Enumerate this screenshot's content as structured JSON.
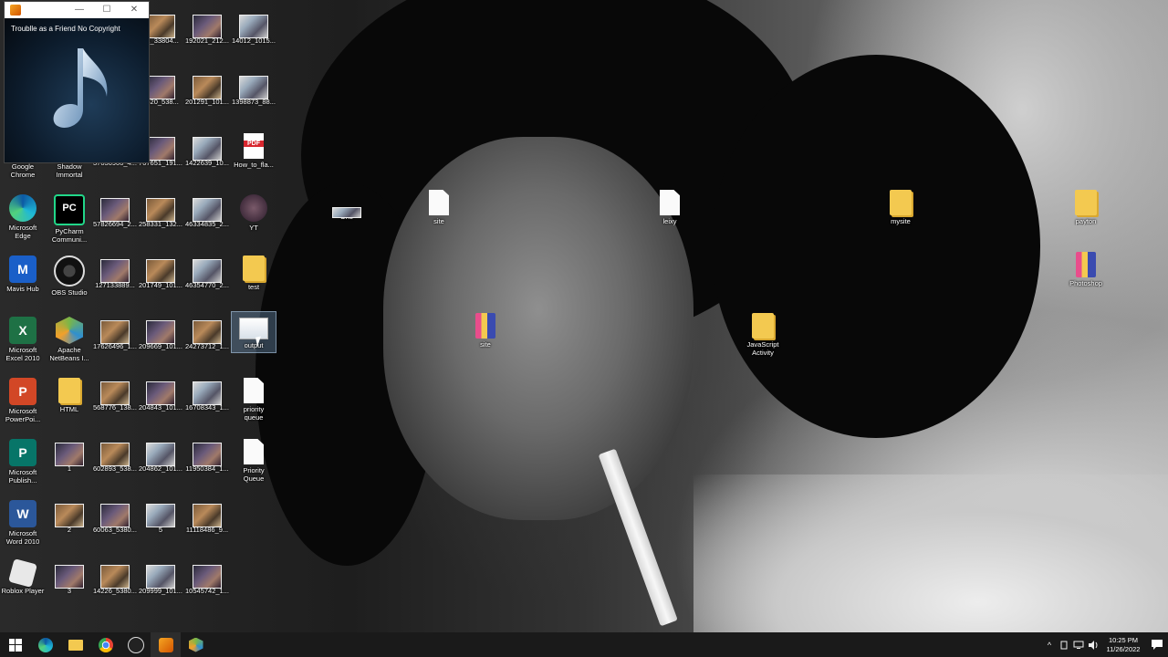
{
  "media_player": {
    "track_title": "Troublle as a Friend No Copyright",
    "controls": {
      "minimize": "—",
      "maximize": "☐",
      "close": "✕"
    },
    "art": "music-note-icon"
  },
  "desktop": {
    "icons": [
      {
        "label": "92_33804...",
        "kind": "thumb"
      },
      {
        "label": "192021_212...",
        "kind": "thumb"
      },
      {
        "label": "14012_1015...",
        "kind": "thumb"
      },
      {
        "label": "3620_538...",
        "kind": "thumb"
      },
      {
        "label": "201291_101...",
        "kind": "thumb"
      },
      {
        "label": "1398873_88...",
        "kind": "thumb"
      },
      {
        "label": "Google\nChrome",
        "kind": "app"
      },
      {
        "label": "Shadow\nImmortal",
        "kind": "app"
      },
      {
        "label": "37030900_4...",
        "kind": "thumb"
      },
      {
        "label": "767651_191...",
        "kind": "thumb"
      },
      {
        "label": "1422639_10...",
        "kind": "thumb"
      },
      {
        "label": "How_to_fla...",
        "kind": "pdf"
      },
      {
        "label": "Microsoft\nEdge",
        "kind": "app"
      },
      {
        "label": "PyCharm\nCommuni...",
        "kind": "app"
      },
      {
        "label": "57826694_2...",
        "kind": "thumb"
      },
      {
        "label": "258331_132...",
        "kind": "thumb"
      },
      {
        "label": "46334835_2...",
        "kind": "thumb"
      },
      {
        "label": "YT",
        "kind": "thumb"
      },
      {
        "label": "Mavis Hub",
        "kind": "app"
      },
      {
        "label": "OBS Studio",
        "kind": "app"
      },
      {
        "label": "127133889...",
        "kind": "thumb"
      },
      {
        "label": "201749_101...",
        "kind": "thumb"
      },
      {
        "label": "46354770_2...",
        "kind": "thumb"
      },
      {
        "label": "test",
        "kind": "folder"
      },
      {
        "label": "Microsoft\nExcel 2010",
        "kind": "app"
      },
      {
        "label": "Apache\nNetBeans I...",
        "kind": "app"
      },
      {
        "label": "17626496_1...",
        "kind": "thumb"
      },
      {
        "label": "209669_101...",
        "kind": "thumb"
      },
      {
        "label": "24273712_1...",
        "kind": "thumb"
      },
      {
        "label": "output",
        "kind": "selected"
      },
      {
        "label": "Microsoft\nPowerPoi...",
        "kind": "app"
      },
      {
        "label": "HTML",
        "kind": "folder"
      },
      {
        "label": "568776_138...",
        "kind": "thumb"
      },
      {
        "label": "204843_101...",
        "kind": "thumb"
      },
      {
        "label": "16708343_1...",
        "kind": "thumb"
      },
      {
        "label": "priority\nqueue",
        "kind": "doc"
      },
      {
        "label": "Microsoft\nPublish...",
        "kind": "app"
      },
      {
        "label": "1",
        "kind": "thumb"
      },
      {
        "label": "602893_538...",
        "kind": "thumb"
      },
      {
        "label": "204862_101...",
        "kind": "thumb"
      },
      {
        "label": "11950384_1...",
        "kind": "thumb"
      },
      {
        "label": "Priority\nQueue",
        "kind": "doc"
      },
      {
        "label": "Microsoft\nWord 2010",
        "kind": "app"
      },
      {
        "label": "2",
        "kind": "thumb"
      },
      {
        "label": "60063_5380...",
        "kind": "thumb"
      },
      {
        "label": "5",
        "kind": "thumb"
      },
      {
        "label": "11118486_9...",
        "kind": "thumb"
      },
      {
        "label": "Roblox Player",
        "kind": "app"
      },
      {
        "label": "3",
        "kind": "thumb"
      },
      {
        "label": "14226_5380...",
        "kind": "thumb"
      },
      {
        "label": "209999_101...",
        "kind": "thumb"
      },
      {
        "label": "10545742_1...",
        "kind": "thumb"
      },
      {
        "label": "One",
        "kind": "thumb"
      },
      {
        "label": "site",
        "kind": "doc"
      },
      {
        "label": "leixy",
        "kind": "doc"
      },
      {
        "label": "mysite",
        "kind": "folder"
      },
      {
        "label": "payton",
        "kind": "folder"
      },
      {
        "label": "Photoshop",
        "kind": "zip"
      },
      {
        "label": "site",
        "kind": "zip"
      },
      {
        "label": "JavaScript\nActivity",
        "kind": "folder"
      }
    ]
  },
  "taskbar": {
    "pinned": [
      "windows-start-icon",
      "edge-icon",
      "file-explorer-icon",
      "chrome-icon",
      "obs-icon",
      "media-player-icon",
      "netbeans-icon"
    ],
    "tray": {
      "chevron": "^",
      "time": "10:25 PM",
      "date": "11/26/2022"
    }
  }
}
